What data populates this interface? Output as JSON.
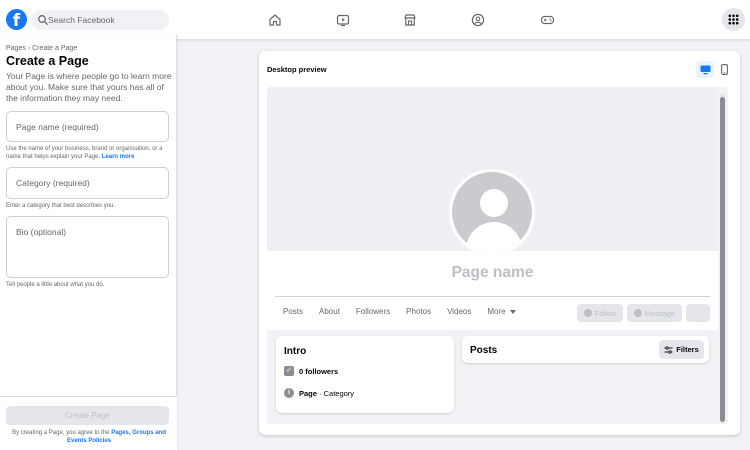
{
  "topnav": {
    "logo_glyph": "f",
    "search_placeholder": "Search Facebook",
    "icons": [
      "home-icon",
      "video-icon",
      "marketplace-icon",
      "groups-icon",
      "gaming-icon",
      "menu-grid-icon"
    ]
  },
  "left": {
    "breadcrumb": "Pages › Create a Page",
    "title": "Create a Page",
    "description": "Your Page is where people go to learn more about you. Make sure that yours has all of the information they may need.",
    "page_name_placeholder": "Page name (required)",
    "page_name_hint": "Use the name of your business, brand or organisation, or a name that helps explain your Page.",
    "learn_more": "Learn more",
    "category_placeholder": "Category (required)",
    "category_hint": "Enter a category that best describes you.",
    "bio_placeholder": "Bio (optional)",
    "bio_hint": "Tell people a little about what you do.",
    "create_button": "Create Page",
    "terms_prefix": "By creating a Page, you agree to the",
    "terms_link": "Pages, Groups and Events Policies"
  },
  "preview": {
    "title": "Desktop preview",
    "page_name": "Page name",
    "tabs": [
      "Posts",
      "About",
      "Followers",
      "Photos",
      "Videos",
      "More"
    ],
    "follow_button": "Follow",
    "message_button": "Message",
    "more_button": "···",
    "intro_title": "Intro",
    "followers": "0 followers",
    "page_label": "Page",
    "category_text": " · Category",
    "posts_title": "Posts",
    "filters_button": "Filters"
  },
  "colors": {
    "brand": "#1877f2",
    "background": "#f0f2f5",
    "disabled_text": "#bcc0c4"
  }
}
